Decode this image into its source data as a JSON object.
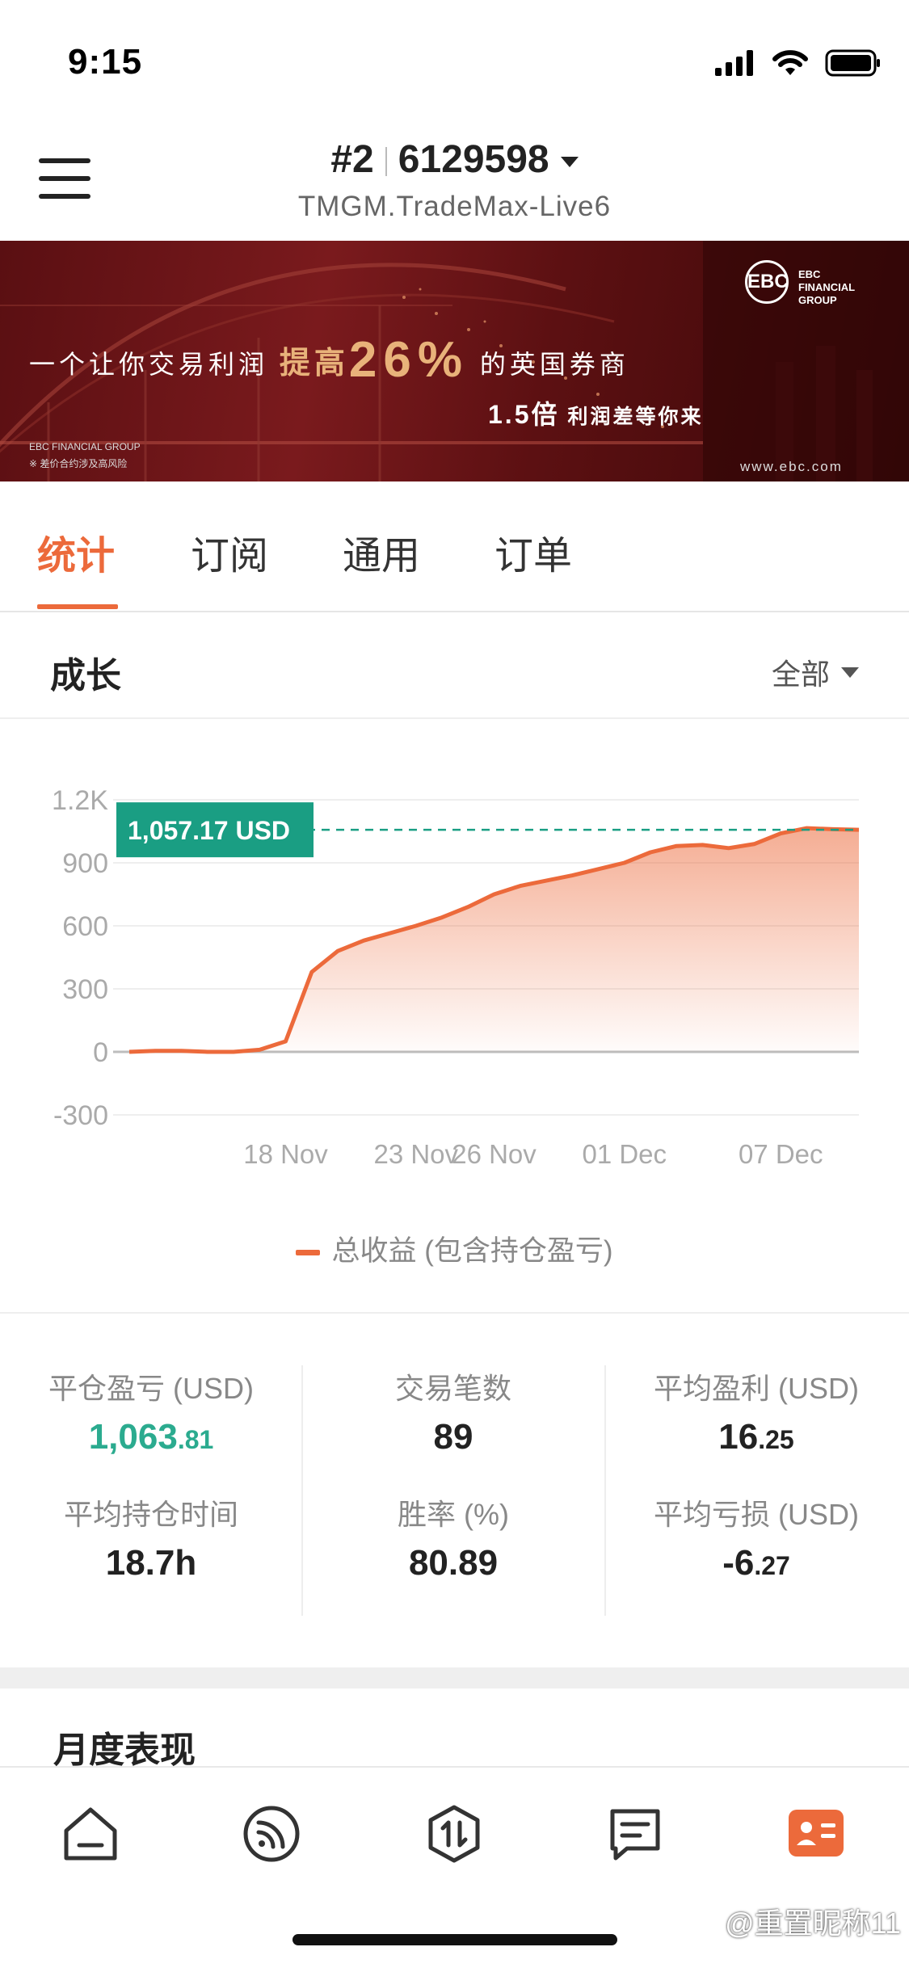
{
  "status_bar": {
    "time": "9:15"
  },
  "header": {
    "account_index": "#2",
    "account_number": "6129598",
    "server": "TMGM.TradeMax-Live6"
  },
  "banner": {
    "headline_pre": "一个让你交易利润",
    "headline_highlight": "提高",
    "headline_big": "26%",
    "headline_post": "的英国券商",
    "sub_num": "1.5倍",
    "sub_text": "利润差等你来",
    "brand_mark": "EBC",
    "brand_line1": "EBC",
    "brand_line2": "FINANCIAL",
    "brand_line3": "GROUP",
    "footer_brand": "EBC FINANCIAL GROUP",
    "footer_risk": "※ 差价合约涉及高风险",
    "url": "www.ebc.com"
  },
  "tabs": [
    "统计",
    "订阅",
    "通用",
    "订单"
  ],
  "growth": {
    "title": "成长",
    "filter": "全部"
  },
  "chart_data": {
    "type": "area",
    "series": [
      {
        "name": "总收益 (包含持仓盈亏)",
        "x": [
          "12 Nov",
          "13 Nov",
          "14 Nov",
          "15 Nov",
          "16 Nov",
          "17 Nov",
          "18 Nov",
          "19 Nov",
          "20 Nov",
          "21 Nov",
          "22 Nov",
          "23 Nov",
          "24 Nov",
          "25 Nov",
          "26 Nov",
          "27 Nov",
          "28 Nov",
          "29 Nov",
          "30 Nov",
          "01 Dec",
          "02 Dec",
          "03 Dec",
          "04 Dec",
          "05 Dec",
          "06 Dec",
          "07 Dec",
          "08 Dec",
          "09 Dec",
          "10 Dec"
        ],
        "values": [
          0,
          5,
          5,
          0,
          0,
          10,
          50,
          380,
          480,
          530,
          565,
          600,
          640,
          690,
          750,
          790,
          815,
          840,
          870,
          900,
          950,
          980,
          985,
          970,
          990,
          1040,
          1065,
          1060,
          1057.17
        ]
      }
    ],
    "x_ticks": [
      "18 Nov",
      "23 Nov",
      "26 Nov",
      "01 Dec",
      "07 Dec"
    ],
    "y_ticks": [
      "1.2K",
      "900",
      "600",
      "300",
      "0",
      "-300"
    ],
    "ylim": [
      -300,
      1200
    ],
    "last_value_label": "1,057.17 USD",
    "grid": true,
    "legend": "bottom-center"
  },
  "stats": [
    {
      "label": "平仓盈亏 (USD)",
      "value_int": "1,063",
      "value_dec": ".81",
      "color": "#2bab8f"
    },
    {
      "label": "交易笔数",
      "value_int": "89",
      "value_dec": ""
    },
    {
      "label": "平均盈利 (USD)",
      "value_int": "16",
      "value_dec": ".25"
    },
    {
      "label": "平均持仓时间",
      "value_int": "18.7h",
      "value_dec": ""
    },
    {
      "label": "胜率 (%)",
      "value_int": "80.89",
      "value_dec": ""
    },
    {
      "label": "平均亏损 (USD)",
      "value_int": "-6",
      "value_dec": ".27"
    }
  ],
  "monthly": {
    "title": "月度表现"
  },
  "bottom_nav": [
    "home-icon",
    "feed-icon",
    "trade-icon",
    "messages-icon",
    "profile-icon"
  ],
  "colors": {
    "accent": "#ec6a3b",
    "positive": "#2bab8f",
    "label_bg": "#1a9e83"
  },
  "watermark": "@重置昵称11"
}
